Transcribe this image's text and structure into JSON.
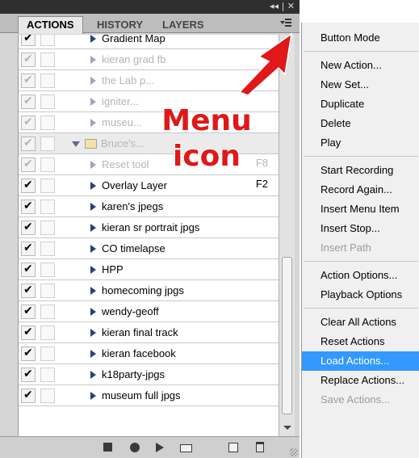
{
  "titlebar": {
    "controls": "◂◂ | ✕"
  },
  "tabs": [
    {
      "label": "ACTIONS",
      "active": true
    },
    {
      "label": "HISTORY",
      "active": false
    },
    {
      "label": "LAYERS",
      "active": false
    }
  ],
  "menu_button": {
    "icon": "panel-menu-icon"
  },
  "actions_list": [
    {
      "label": "Gradient Map",
      "key": "",
      "faded": false,
      "type": "action"
    },
    {
      "label": "kieran grad fb",
      "key": "",
      "faded": true,
      "type": "action"
    },
    {
      "label": "the Lab p...",
      "key": "",
      "faded": true,
      "type": "action"
    },
    {
      "label": "igniter...",
      "key": "",
      "faded": true,
      "type": "action"
    },
    {
      "label": "museu...",
      "key": "",
      "faded": true,
      "type": "action"
    },
    {
      "label": "Bruce's...",
      "key": "",
      "faded": true,
      "type": "set"
    },
    {
      "label": "Reset tool",
      "key": "F8",
      "faded": true,
      "type": "action"
    },
    {
      "label": "Overlay Layer",
      "key": "F2",
      "faded": false,
      "type": "action"
    },
    {
      "label": "karen's jpegs",
      "key": "",
      "faded": false,
      "type": "action"
    },
    {
      "label": "kieran sr portrait jpgs",
      "key": "",
      "faded": false,
      "type": "action"
    },
    {
      "label": "CO timelapse",
      "key": "",
      "faded": false,
      "type": "action"
    },
    {
      "label": "HPP",
      "key": "",
      "faded": false,
      "type": "action"
    },
    {
      "label": "homecoming jpgs",
      "key": "",
      "faded": false,
      "type": "action"
    },
    {
      "label": "wendy-geoff",
      "key": "",
      "faded": false,
      "type": "action"
    },
    {
      "label": "kieran final track",
      "key": "",
      "faded": false,
      "type": "action"
    },
    {
      "label": "kieran facebook",
      "key": "",
      "faded": false,
      "type": "action"
    },
    {
      "label": "k18party-jpgs",
      "key": "",
      "faded": false,
      "type": "action"
    },
    {
      "label": "museum full jpgs",
      "key": "",
      "faded": false,
      "type": "action"
    }
  ],
  "checkmark": "✔",
  "annotation": {
    "line1": "Menu",
    "line2": "icon",
    "color": "#e01818"
  },
  "menu": {
    "groups": [
      [
        {
          "label": "Button Mode",
          "disabled": false
        }
      ],
      [
        {
          "label": "New Action...",
          "disabled": false
        },
        {
          "label": "New Set...",
          "disabled": false
        },
        {
          "label": "Duplicate",
          "disabled": false
        },
        {
          "label": "Delete",
          "disabled": false
        },
        {
          "label": "Play",
          "disabled": false
        }
      ],
      [
        {
          "label": "Start Recording",
          "disabled": false
        },
        {
          "label": "Record Again...",
          "disabled": false
        },
        {
          "label": "Insert Menu Item",
          "disabled": false
        },
        {
          "label": "Insert Stop...",
          "disabled": false
        },
        {
          "label": "Insert Path",
          "disabled": true
        }
      ],
      [
        {
          "label": "Action Options...",
          "disabled": false
        },
        {
          "label": "Playback Options",
          "disabled": false
        }
      ],
      [
        {
          "label": "Clear All Actions",
          "disabled": false
        },
        {
          "label": "Reset Actions",
          "disabled": false
        },
        {
          "label": "Load Actions...",
          "disabled": false,
          "highlighted": true
        },
        {
          "label": "Replace Actions...",
          "disabled": false
        },
        {
          "label": "Save Actions...",
          "disabled": true
        }
      ]
    ],
    "highlight_color": "#3399ff"
  },
  "bottom_toolbar": {
    "buttons": [
      "stop-icon",
      "record-icon",
      "play-icon",
      "new-set-icon",
      "new-action-icon",
      "delete-icon"
    ]
  }
}
